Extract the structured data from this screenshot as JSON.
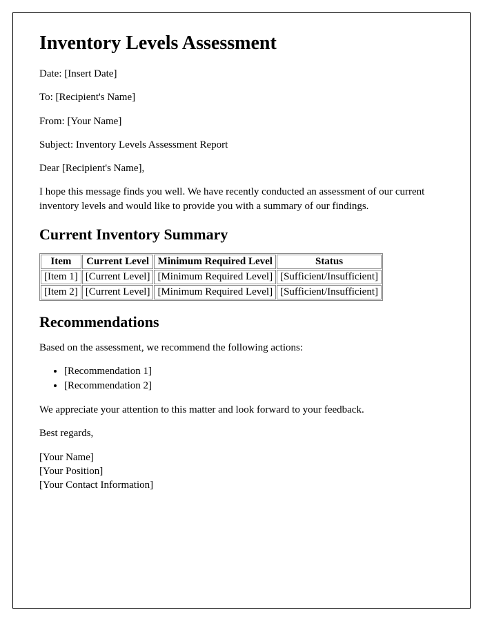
{
  "title": "Inventory Levels Assessment",
  "meta": {
    "date_label": "Date: ",
    "date_value": "[Insert Date]",
    "to_label": "To: ",
    "to_value": "[Recipient's Name]",
    "from_label": "From: ",
    "from_value": "[Your Name]",
    "subject_label": "Subject: ",
    "subject_value": "Inventory Levels Assessment Report"
  },
  "salutation": "Dear [Recipient's Name],",
  "intro": "I hope this message finds you well. We have recently conducted an assessment of our current inventory levels and would like to provide you with a summary of our findings.",
  "summary_heading": "Current Inventory Summary",
  "table": {
    "headers": [
      "Item",
      "Current Level",
      "Minimum Required Level",
      "Status"
    ],
    "rows": [
      [
        "[Item 1]",
        "[Current Level]",
        "[Minimum Required Level]",
        "[Sufficient/Insufficient]"
      ],
      [
        "[Item 2]",
        "[Current Level]",
        "[Minimum Required Level]",
        "[Sufficient/Insufficient]"
      ]
    ]
  },
  "recs_heading": "Recommendations",
  "recs_intro": "Based on the assessment, we recommend the following actions:",
  "recs": [
    "[Recommendation 1]",
    "[Recommendation 2]"
  ],
  "closing": "We appreciate your attention to this matter and look forward to your feedback.",
  "signoff": "Best regards,",
  "signature": {
    "name": "[Your Name]",
    "position": "[Your Position]",
    "contact": "[Your Contact Information]"
  }
}
